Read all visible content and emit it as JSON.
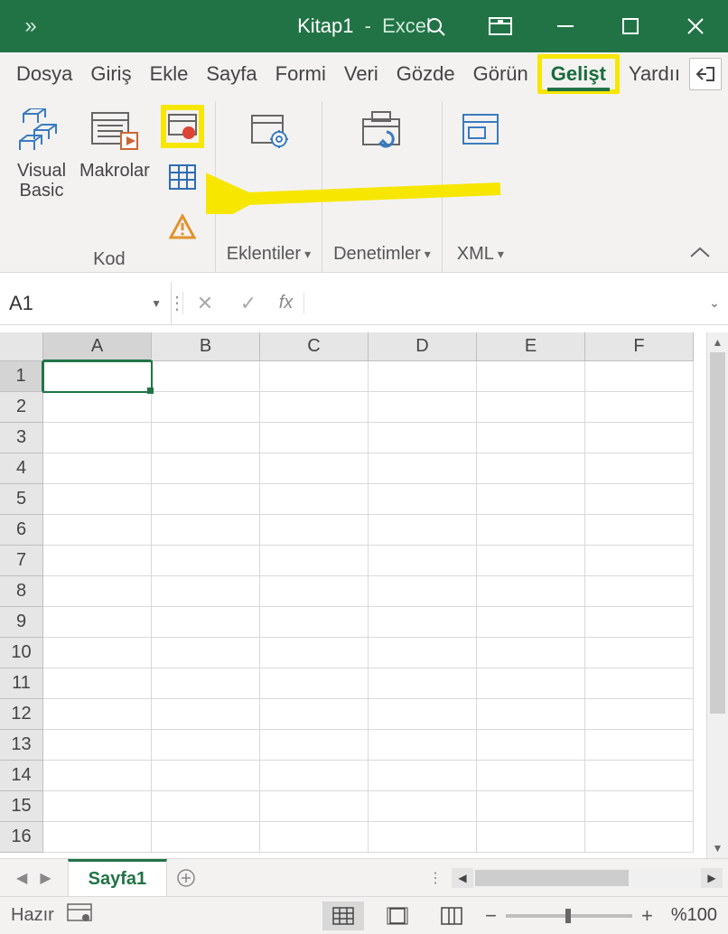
{
  "titlebar": {
    "doc": "Kitap1",
    "app": "Excel"
  },
  "tabs": {
    "items": [
      "Dosya",
      "Giriş",
      "Ekle",
      "Sayfa",
      "Formi",
      "Veri",
      "Gözde",
      "Görün",
      "Gelişt",
      "Yardıı"
    ],
    "active_index": 8
  },
  "ribbon": {
    "group_kod": {
      "label": "Kod",
      "visual_basic": "Visual\nBasic",
      "makrolar": "Makrolar"
    },
    "group_eklentiler": {
      "label": "Eklentiler"
    },
    "group_denetimler": {
      "label": "Denetimler"
    },
    "group_xml": {
      "label": "XML"
    }
  },
  "formulabar": {
    "namebox": "A1",
    "fx": "fx"
  },
  "grid": {
    "columns": [
      "A",
      "B",
      "C",
      "D",
      "E",
      "F"
    ],
    "rows": [
      "1",
      "2",
      "3",
      "4",
      "5",
      "6",
      "7",
      "8",
      "9",
      "10",
      "11",
      "12",
      "13",
      "14",
      "15",
      "16"
    ],
    "active_cell": {
      "col": 0,
      "row": 0
    }
  },
  "sheets": {
    "active": "Sayfa1"
  },
  "status": {
    "ready": "Hazır",
    "zoom": "%100"
  }
}
